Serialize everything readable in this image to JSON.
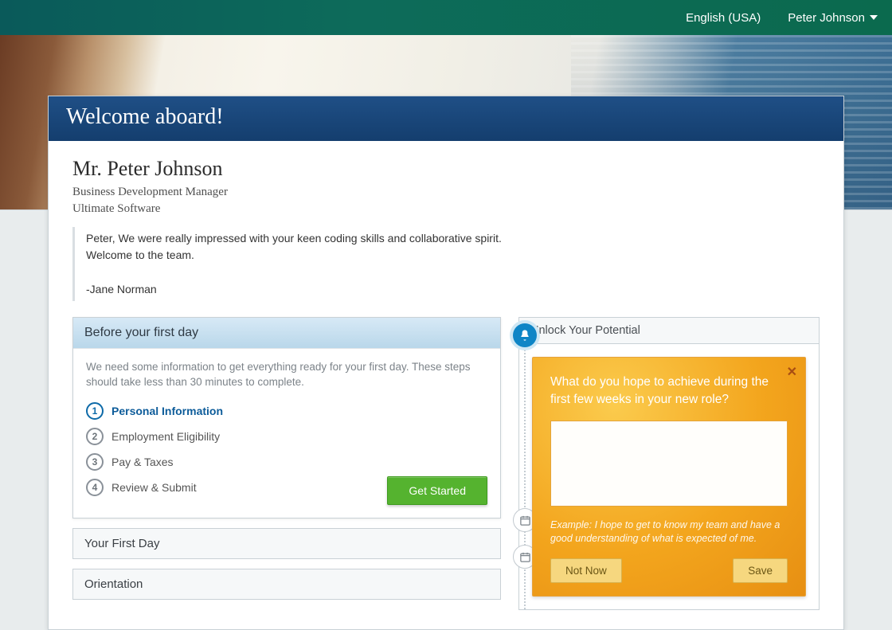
{
  "topnav": {
    "language": "English (USA)",
    "user": "Peter Johnson"
  },
  "header": {
    "title": "Welcome aboard!"
  },
  "person": {
    "name": "Mr. Peter Johnson",
    "role": "Business Development Manager",
    "company": "Ultimate Software"
  },
  "welcome": {
    "line1": "Peter, We were really impressed with your keen coding skills and collaborative spirit.",
    "line2": "Welcome to the team.",
    "signature": "-Jane Norman"
  },
  "panels": {
    "before": {
      "title": "Before your first day",
      "desc": "We need some information to get everything ready for your first day. These steps should take less than 30 minutes to complete.",
      "steps": [
        "Personal Information",
        "Employment Eligibility",
        "Pay & Taxes",
        "Review & Submit"
      ],
      "get_started": "Get Started"
    },
    "first_day": {
      "title": "Your First Day"
    },
    "orientation": {
      "title": "Orientation"
    }
  },
  "potential": {
    "header": "Unlock Your Potential",
    "question": "What do you hope to achieve during the first few weeks in your new role?",
    "example": "Example: I hope to get to know my team and have a good understanding of what is expected of me.",
    "not_now": "Not Now",
    "save": "Save"
  }
}
